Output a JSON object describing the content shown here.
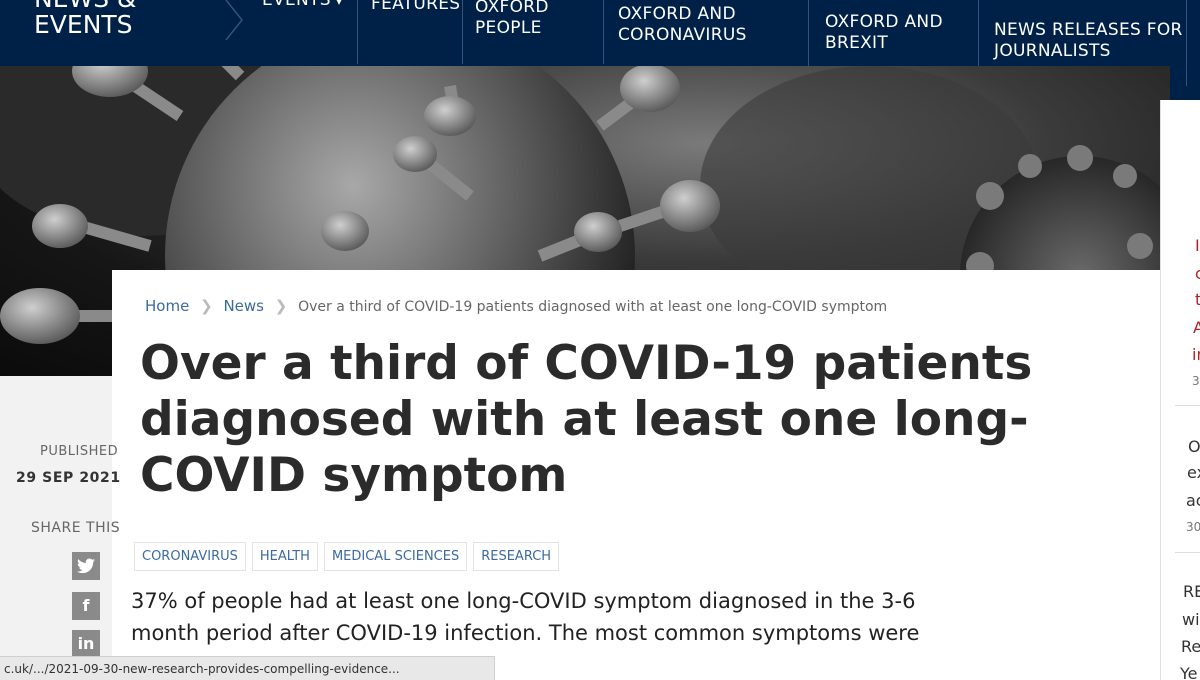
{
  "nav": {
    "brand_line1": "NEWS &",
    "brand_line2": "EVENTS",
    "items": [
      {
        "line1": "EVENTS",
        "line2": ""
      },
      {
        "line1": "FEATURES",
        "line2": ""
      },
      {
        "line1": "OXFORD",
        "line2": "PEOPLE"
      },
      {
        "line1": "OXFORD AND",
        "line2": "CORONAVIRUS"
      },
      {
        "line1": "OXFORD AND",
        "line2": "BREXIT"
      },
      {
        "line1": "NEWS RELEASES FOR",
        "line2": "JOURNALISTS"
      }
    ]
  },
  "breadcrumb": {
    "home": "Home",
    "news": "News",
    "current": "Over a third of COVID-19 patients diagnosed with at least one long-COVID symptom"
  },
  "article": {
    "title_lines": [
      "Over a third of COVID-19 patients",
      "diagnosed with at least one long-",
      "COVID symptom"
    ],
    "published_label": "PUBLISHED",
    "published_date": "29 SEP 2021",
    "share_label": "SHARE THIS",
    "share_icons": [
      "twitter-icon",
      "facebook-icon",
      "linkedin-icon"
    ],
    "tags": [
      "CORONAVIRUS",
      "HEALTH",
      "MEDICAL SCIENCES",
      "RESEARCH"
    ],
    "lead_lines": [
      "37% of people had at least one long-COVID symptom diagnosed in the 3-6",
      "month period after COVID-19 infection. The most common symptoms were"
    ]
  },
  "right_column": {
    "fragments": [
      {
        "text": "I",
        "style": "red"
      },
      {
        "text": "c",
        "style": "red"
      },
      {
        "text": "t",
        "style": "red"
      },
      {
        "text": "A",
        "style": "red"
      },
      {
        "text": "in",
        "style": "red"
      },
      {
        "text": "3",
        "style": "small"
      },
      {
        "text": "O",
        "style": "normal"
      },
      {
        "text": "ex",
        "style": "normal"
      },
      {
        "text": "ac",
        "style": "normal"
      },
      {
        "text": "30",
        "style": "small"
      },
      {
        "text": "RE",
        "style": "normal"
      },
      {
        "text": "wi",
        "style": "normal"
      },
      {
        "text": "Re",
        "style": "normal"
      },
      {
        "text": "Ye",
        "style": "normal"
      }
    ]
  },
  "status_bar": {
    "url": "c.uk/.../2021-09-30-new-research-provides-compelling-evidence..."
  },
  "colors": {
    "nav_bg": "#002147",
    "link": "#3b6aa0",
    "accent_red": "#b22222"
  }
}
